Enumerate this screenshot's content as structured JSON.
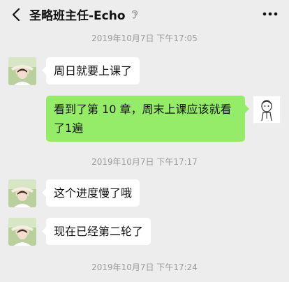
{
  "header": {
    "title": "圣略班主任-Echo",
    "back_icon": "chevron-left-icon",
    "ear_icon": "ear-icon",
    "more_icon": "more-dots-icon"
  },
  "colors": {
    "background": "#ededed",
    "incoming_bubble": "#ffffff",
    "outgoing_bubble": "#95ec69",
    "timestamp_text": "#9a9a9a"
  },
  "messages": [
    {
      "kind": "timestamp",
      "text": "2019年10月7日 下午17:05"
    },
    {
      "kind": "incoming",
      "sender": "圣略班主任-Echo",
      "text": "周日就要上课了"
    },
    {
      "kind": "outgoing",
      "text": "看到了第 10 章，周末上课应该就看了1遍"
    },
    {
      "kind": "timestamp",
      "text": "2019年10月7日 下午17:17"
    },
    {
      "kind": "incoming",
      "sender": "圣略班主任-Echo",
      "text": "这个进度慢了哦"
    },
    {
      "kind": "incoming",
      "sender": "圣略班主任-Echo",
      "text": "现在已经第二轮了"
    },
    {
      "kind": "timestamp",
      "text": "2019年10月7日 下午17:24"
    }
  ]
}
